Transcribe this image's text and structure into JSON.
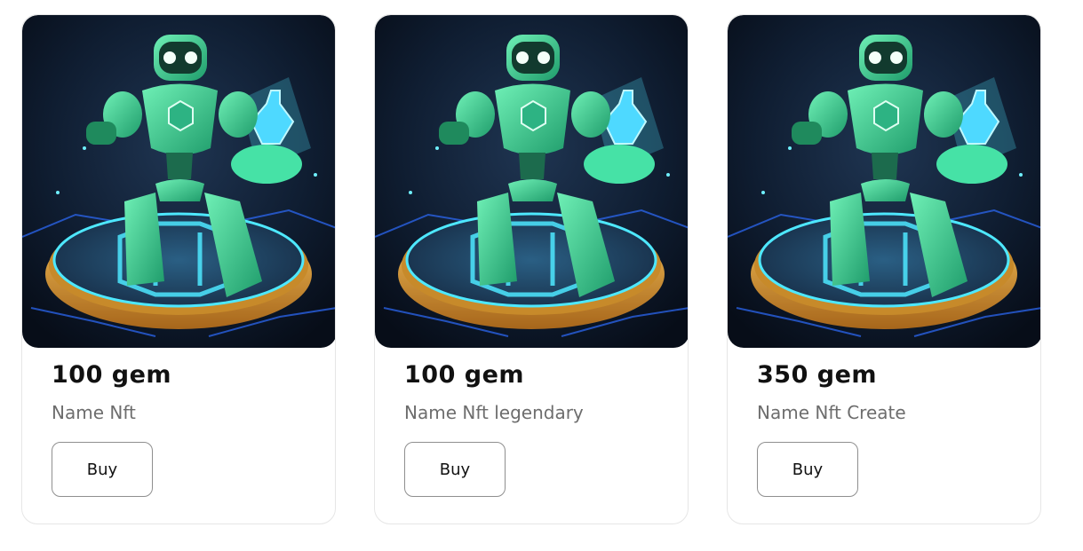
{
  "cards": [
    {
      "price": "100 gem",
      "name": "Name Nft",
      "buy_label": "Buy"
    },
    {
      "price": "100 gem",
      "name": "Name Nft legendary",
      "buy_label": "Buy"
    },
    {
      "price": "350 gem",
      "name": "Name Nft Create",
      "buy_label": "Buy"
    }
  ],
  "colors": {
    "robot": "#3fd196",
    "pedestal_ring": "#e0a83a",
    "glow": "#4ee8ff",
    "background": "#0b1626"
  },
  "artwork": "robot-on-pedestal-image"
}
